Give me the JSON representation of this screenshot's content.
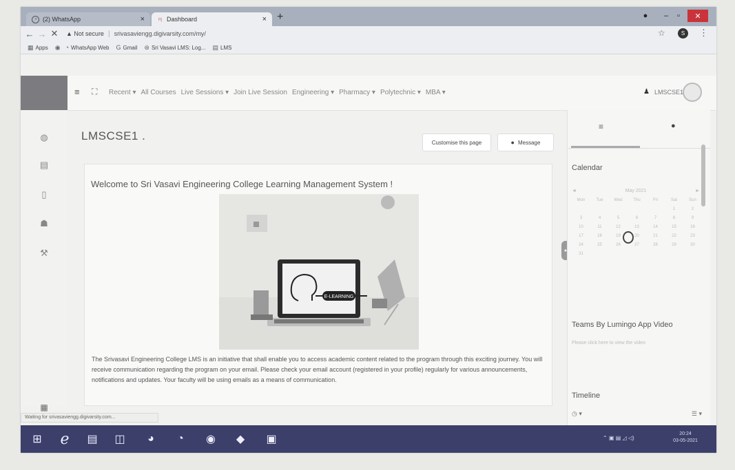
{
  "browser": {
    "tabs": [
      {
        "label": "(2) WhatsApp",
        "icon": "whatsapp-icon",
        "close": "×"
      },
      {
        "label": "Dashboard",
        "icon": "moodle-icon",
        "close": "×"
      }
    ],
    "new_tab": "+",
    "not_secure": "Not secure",
    "url": "srivasaviengg.digivarsity.com/my/",
    "bookmarks": [
      "Apps",
      "WhatsApp Web",
      "Gmail",
      "Sri Vasavi LMS: Log...",
      "LMS"
    ]
  },
  "lms": {
    "nav": [
      "Recent ▾",
      "All Courses",
      "Live Sessions ▾",
      "Join Live Session",
      "Engineering ▾",
      "Pharmacy ▾",
      "Polytechnic ▾",
      "MBA ▾"
    ],
    "username": "LMSCSE1 ."
  },
  "main": {
    "page_title": "LMSCSE1 .",
    "customise_label": "Customise this page",
    "message_label": "Message",
    "welcome": "Welcome to Sri Vasavi Engineering College Learning Management System !",
    "hero_badge": "E-LEARNING",
    "description": "The Srivasavi Engineering College LMS is an initiative that shall enable you to access academic content related to the program through this exciting journey. You will receive communication regarding the program on your email. Please check your email account (registered in your profile) regularly for various announcements, notifications and updates. Your faculty will be using emails as a means of communication."
  },
  "right": {
    "calendar_title": "Calendar",
    "month": "May 2021",
    "weekdays": [
      "Mon",
      "Tue",
      "Wed",
      "Thu",
      "Fri",
      "Sat",
      "Sun"
    ],
    "weeks": [
      [
        "",
        "",
        "",
        "",
        "",
        "1",
        "2"
      ],
      [
        "3",
        "4",
        "5",
        "6",
        "7",
        "8",
        "9"
      ],
      [
        "10",
        "11",
        "12",
        "13",
        "14",
        "15",
        "16"
      ],
      [
        "17",
        "18",
        "19",
        "20",
        "21",
        "22",
        "23"
      ],
      [
        "24",
        "25",
        "26",
        "27",
        "28",
        "29",
        "30"
      ],
      [
        "31",
        "",
        "",
        "",
        "",
        "",
        ""
      ]
    ],
    "teams_title": "Teams By Lumingo App Video",
    "teams_text": "Please click here to view the video",
    "timeline_title": "Timeline"
  },
  "status_text": "Waiting for srivasaviengg.digivarsity.com...",
  "taskbar": {
    "time": "20:24",
    "date": "03-05-2021"
  }
}
